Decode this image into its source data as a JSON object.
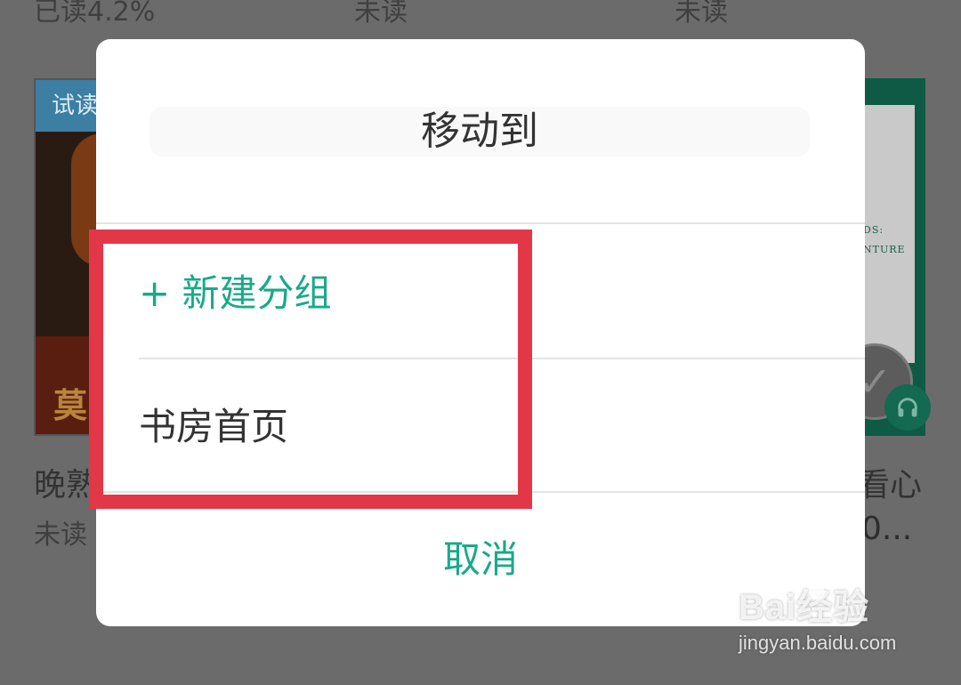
{
  "background": {
    "progress_labels": [
      "已读4.2%",
      "未读",
      "未读"
    ],
    "trial_tag": "试读",
    "left_book_cover_char": "莫",
    "right_book_cover_text": [
      "DS:",
      "NTURE"
    ],
    "left_book_title": "晚熟",
    "left_book_status": "未读",
    "right_book_title": "看心",
    "right_book_subtitle": "0..."
  },
  "dialog": {
    "title": "移动到",
    "new_group_label": "+ 新建分组",
    "home_label": "书房首页",
    "cancel_label": "取消"
  },
  "watermark": {
    "logo": "Bai经验",
    "url": "jingyan.baidu.com"
  },
  "colors": {
    "accent": "#1aa98a",
    "highlight": "#e23747",
    "overlay": "#6b6b6b"
  },
  "icons": {
    "check": "check-circle-icon",
    "headphones": "headphones-icon"
  }
}
